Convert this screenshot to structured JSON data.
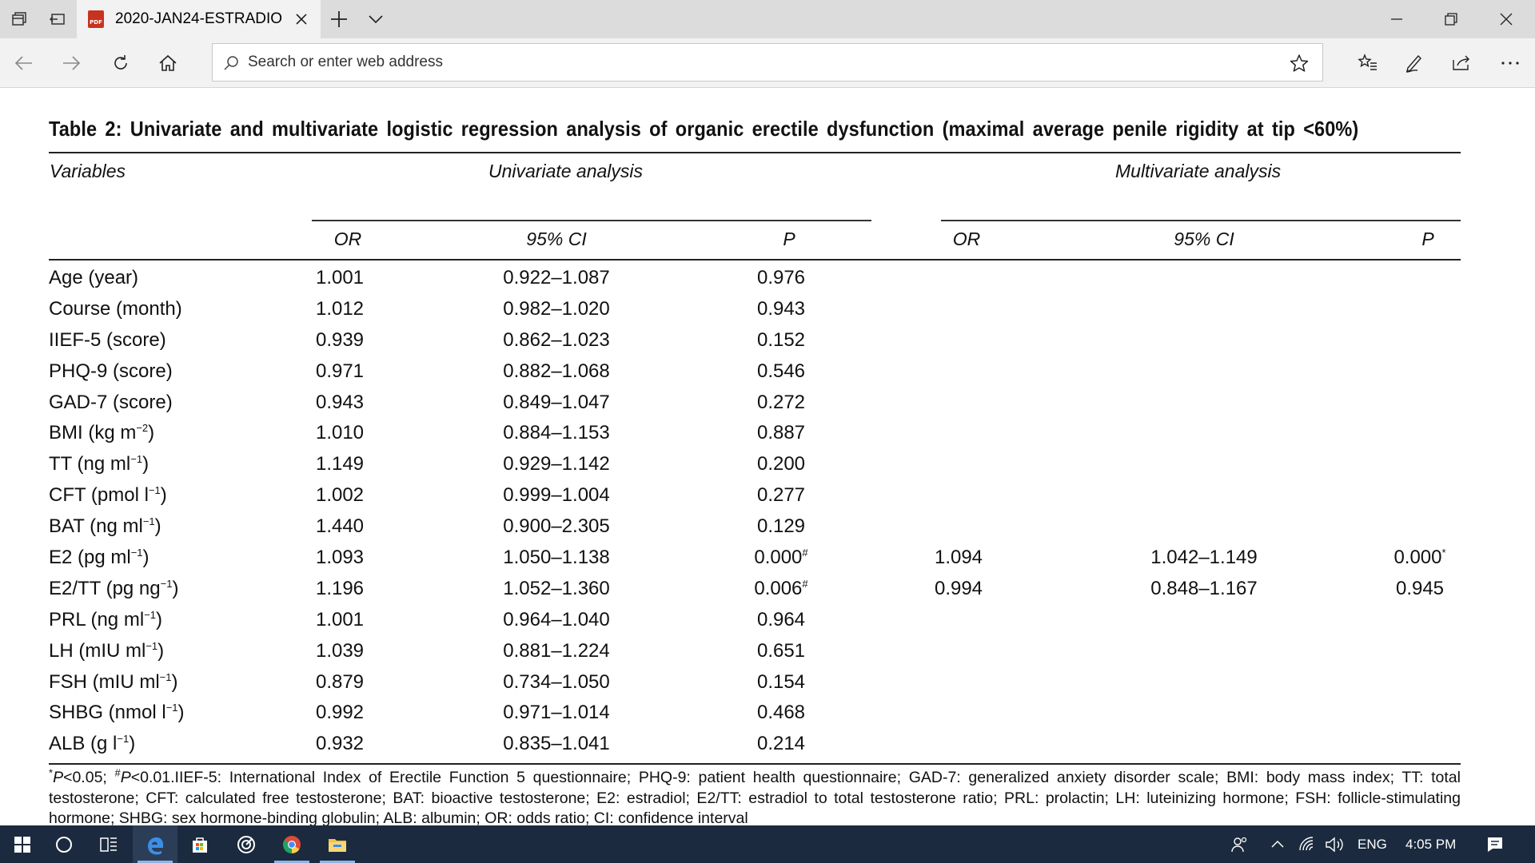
{
  "browser": {
    "tab_title": "2020-JAN24-ESTRADIO",
    "pdf_badge": "PDF",
    "address_placeholder": "Search or enter web address",
    "accent": "#c8331f"
  },
  "table": {
    "title": "Table 2: Univariate and multivariate logistic regression analysis of organic erectile dysfunction (maximal average penile rigidity at tip <60%)",
    "header_variables": "Variables",
    "header_univariate": "Univariate analysis",
    "header_multivariate": "Multivariate analysis",
    "sub_or": "OR",
    "sub_ci": "95% CI",
    "sub_p": "P",
    "rows": [
      {
        "var": "Age (year)",
        "or": "1.001",
        "ci": "0.922–1.087",
        "p": "0.976"
      },
      {
        "var": "Course (month)",
        "or": "1.012",
        "ci": "0.982–1.020",
        "p": "0.943"
      },
      {
        "var": "IIEF-5 (score)",
        "or": "0.939",
        "ci": "0.862–1.023",
        "p": "0.152"
      },
      {
        "var": "PHQ-9 (score)",
        "or": "0.971",
        "ci": "0.882–1.068",
        "p": "0.546"
      },
      {
        "var": "GAD-7 (score)",
        "or": "0.943",
        "ci": "0.849–1.047",
        "p": "0.272"
      },
      {
        "var": "BMI (kg m",
        "var_sup": "−2",
        "var_end": ")",
        "or": "1.010",
        "ci": "0.884–1.153",
        "p": "0.887"
      },
      {
        "var": "TT (ng ml",
        "var_sup": "−1",
        "var_end": ")",
        "or": "1.149",
        "ci": "0.929–1.142",
        "p": "0.200"
      },
      {
        "var": "CFT (pmol l",
        "var_sup": "−1",
        "var_end": ")",
        "or": "1.002",
        "ci": "0.999–1.004",
        "p": "0.277"
      },
      {
        "var": "BAT (ng ml",
        "var_sup": "−1",
        "var_end": ")",
        "or": "1.440",
        "ci": "0.900–2.305",
        "p": "0.129"
      },
      {
        "var": "E2 (pg ml",
        "var_sup": "−1",
        "var_end": ")",
        "or": "1.093",
        "ci": "1.050–1.138",
        "p": "0.000",
        "p_sup": "#",
        "mor": "1.094",
        "mci": "1.042–1.149",
        "mp": "0.000",
        "mp_sup": "*"
      },
      {
        "var": "E2/TT (pg ng",
        "var_sup": "−1",
        "var_end": ")",
        "or": "1.196",
        "ci": "1.052–1.360",
        "p": "0.006",
        "p_sup": "#",
        "mor": "0.994",
        "mci": "0.848–1.167",
        "mp": "0.945"
      },
      {
        "var": "PRL (ng ml",
        "var_sup": "−1",
        "var_end": ")",
        "or": "1.001",
        "ci": "0.964–1.040",
        "p": "0.964"
      },
      {
        "var": "LH (mIU ml",
        "var_sup": "−1",
        "var_end": ")",
        "or": "1.039",
        "ci": "0.881–1.224",
        "p": "0.651"
      },
      {
        "var": "FSH (mIU ml",
        "var_sup": "−1",
        "var_end": ")",
        "or": "0.879",
        "ci": "0.734–1.050",
        "p": "0.154"
      },
      {
        "var": "SHBG (nmol l",
        "var_sup": "−1",
        "var_end": ")",
        "or": "0.992",
        "ci": "0.971–1.014",
        "p": "0.468"
      },
      {
        "var": "ALB (g l",
        "var_sup": "−1",
        "var_end": ")",
        "or": "0.932",
        "ci": "0.835–1.041",
        "p": "0.214"
      }
    ],
    "footnote": {
      "star": "*",
      "p1": "P",
      "t1": "<0.05; ",
      "hash": "#",
      "p2": "P",
      "t2": "<0.01.IIEF-5: International Index of Erectile Function 5 questionnaire; PHQ-9: patient health questionnaire; GAD-7: generalized anxiety disorder scale; BMI: body mass index; TT: total testosterone; CFT: calculated free testosterone; BAT: bioactive testosterone; E2: estradiol; E2/TT: estradiol to total testosterone ratio; PRL: prolactin; LH: luteinizing hormone; FSH: follicle-stimulating hormone; SHBG: sex hormone-binding globulin; ALB: albumin; OR: odds ratio; CI: confidence interval"
    }
  },
  "taskbar": {
    "language": "ENG",
    "time": "4:05 PM",
    "bg": "#1b2a3f"
  }
}
